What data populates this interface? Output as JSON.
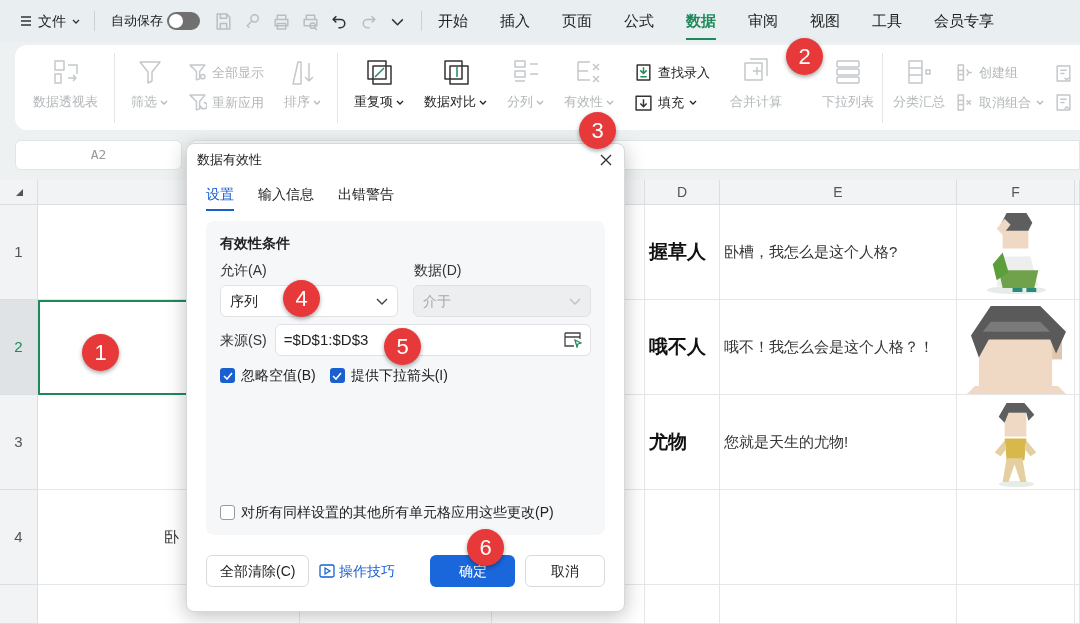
{
  "title_bar": {
    "file_menu": "文件",
    "autosave": {
      "label": "自动保存",
      "on": false
    },
    "quick_access": [
      {
        "disabled": true
      },
      {
        "disabled": true
      },
      {
        "disabled": true
      },
      {
        "disabled": true
      },
      {
        "disabled": false
      },
      {
        "disabled": true
      },
      {
        "disabled": false
      }
    ],
    "tabs": [
      {
        "label": "开始",
        "selected": false
      },
      {
        "label": "插入",
        "selected": false
      },
      {
        "label": "页面",
        "selected": false
      },
      {
        "label": "公式",
        "selected": false
      },
      {
        "label": "数据",
        "selected": true
      },
      {
        "label": "审阅",
        "selected": false
      },
      {
        "label": "视图",
        "selected": false
      },
      {
        "label": "工具",
        "selected": false
      },
      {
        "label": "会员专享",
        "selected": false
      }
    ]
  },
  "ribbon": {
    "groups": [
      {
        "items": [
          {
            "kind": "large",
            "label": "数据透视表",
            "disabled": true,
            "dropdown": false
          }
        ]
      },
      {
        "items": [
          {
            "kind": "large",
            "label": "筛选",
            "disabled": true,
            "dropdown": true
          },
          {
            "kind": "stack",
            "items": [
              {
                "label": "全部显示",
                "disabled": true,
                "dropdown": false
              },
              {
                "label": "重新应用",
                "disabled": true,
                "dropdown": false
              }
            ]
          },
          {
            "kind": "large",
            "label": "排序",
            "disabled": true,
            "dropdown": true
          }
        ]
      },
      {
        "items": [
          {
            "kind": "large",
            "label": "重复项",
            "disabled": false,
            "dropdown": true
          },
          {
            "kind": "large",
            "label": "数据对比",
            "disabled": false,
            "dropdown": true
          },
          {
            "kind": "large",
            "label": "分列",
            "disabled": true,
            "dropdown": true
          },
          {
            "kind": "large",
            "label": "有效性",
            "disabled": true,
            "dropdown": true
          },
          {
            "kind": "stack",
            "items": [
              {
                "label": "查找录入",
                "disabled": false,
                "dropdown": false
              },
              {
                "label": "填充",
                "disabled": false,
                "dropdown": true
              }
            ]
          },
          {
            "kind": "large",
            "label": "合并计算",
            "disabled": true,
            "dropdown": false
          },
          {
            "kind": "large",
            "label": "下拉列表",
            "disabled": true,
            "dropdown": false
          }
        ]
      },
      {
        "items": [
          {
            "kind": "large",
            "label": "分类汇总",
            "disabled": true,
            "dropdown": false
          },
          {
            "kind": "stack",
            "items": [
              {
                "label": "创建组",
                "disabled": true,
                "dropdown": false
              },
              {
                "label": "取消组合",
                "disabled": true,
                "dropdown": true
              }
            ]
          },
          {
            "kind": "stack",
            "items": [
              {
                "disabled": true
              },
              {
                "disabled": true
              }
            ]
          }
        ]
      }
    ]
  },
  "name_box": "A2",
  "sheet": {
    "columns": [
      "",
      "",
      "",
      "D",
      "E",
      "F",
      ""
    ],
    "rows": [
      {
        "number": "1",
        "selected": false,
        "cells": [
          "",
          "",
          "",
          "握草人",
          "卧槽，我怎么是这个人格?",
          {
            "kind": "picture"
          },
          ""
        ]
      },
      {
        "number": "2",
        "selected": true,
        "cells": [
          "",
          "",
          "",
          "哦不人",
          "哦不！我怎么会是这个人格？！",
          {
            "kind": "picture"
          },
          ""
        ]
      },
      {
        "number": "3",
        "selected": false,
        "cells": [
          "",
          "",
          "",
          "尤物",
          "您就是天生的尤物!",
          {
            "kind": "picture"
          },
          ""
        ]
      },
      {
        "number": "4",
        "selected": false,
        "cells": [
          "卧",
          "",
          "",
          "",
          "",
          "",
          ""
        ]
      }
    ]
  },
  "dialog": {
    "title": "数据有效性",
    "tabs": [
      {
        "label": "设置",
        "selected": true
      },
      {
        "label": "输入信息",
        "selected": false
      },
      {
        "label": "出错警告",
        "selected": false
      }
    ],
    "section_title": "有效性条件",
    "allow_label": "允许(A)",
    "allow_value": "序列",
    "data_label": "数据(D)",
    "data_value": "介于",
    "data_disabled": true,
    "source_label": "来源(S)",
    "source_value": "=$D$1:$D$3",
    "checkboxes": [
      {
        "label": "忽略空值(B)",
        "checked": true
      },
      {
        "label": "提供下拉箭头(I)",
        "checked": true
      }
    ],
    "apply_all": {
      "label": "对所有同样设置的其他所有单元格应用这些更改(P)",
      "checked": false
    },
    "clear_button": "全部清除(C)",
    "tips_link": "操作技巧",
    "ok_button": "确定",
    "cancel_button": "取消"
  },
  "annotations": [
    "1",
    "2",
    "3",
    "4",
    "5",
    "6"
  ]
}
